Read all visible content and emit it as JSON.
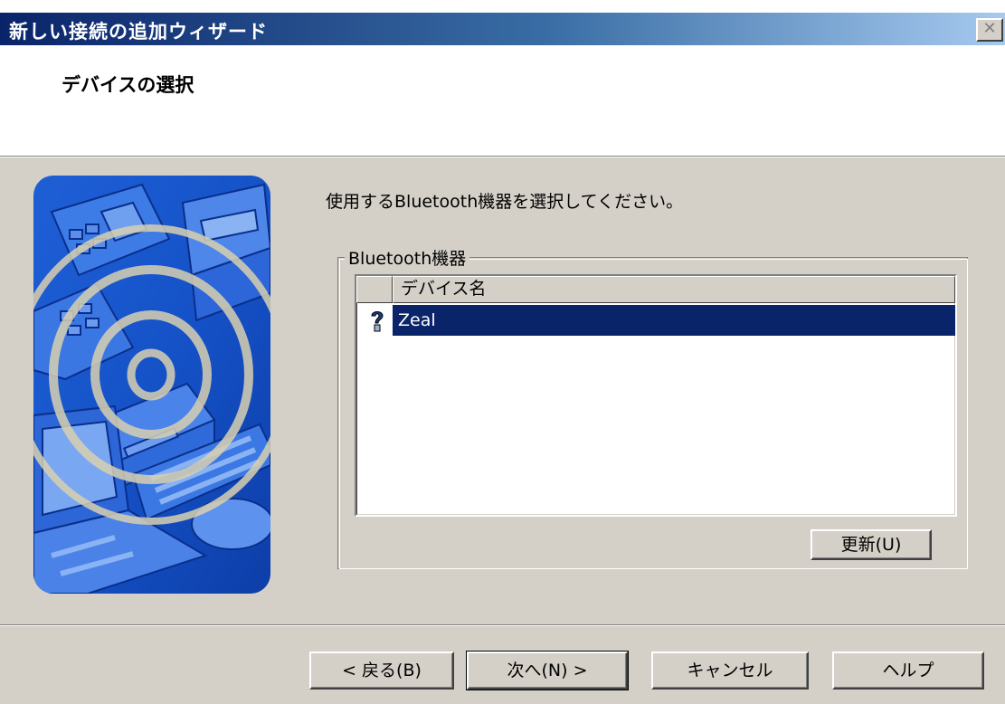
{
  "window": {
    "title": "新しい接続の追加ウィザード",
    "close_glyph": "✕"
  },
  "header": {
    "title": "デバイスの選択"
  },
  "main": {
    "instruction": "使用するBluetooth機器を選択してください。",
    "group_label": "Bluetooth機器",
    "list": {
      "columns": [
        "",
        "デバイス名"
      ],
      "rows": [
        {
          "icon": "question-device-icon",
          "name": "Zeal",
          "selected": true
        }
      ]
    },
    "refresh_button": "更新(U)"
  },
  "footer": {
    "back_button": "< 戻る(B)",
    "next_button": "次へ(N) >",
    "cancel_button": "キャンセル",
    "help_button": "ヘルプ"
  },
  "colors": {
    "titlebar_start": "#0a246a",
    "titlebar_end": "#a6caf0",
    "selection": "#0a246a",
    "dialog_bg": "#d4d0c8"
  }
}
